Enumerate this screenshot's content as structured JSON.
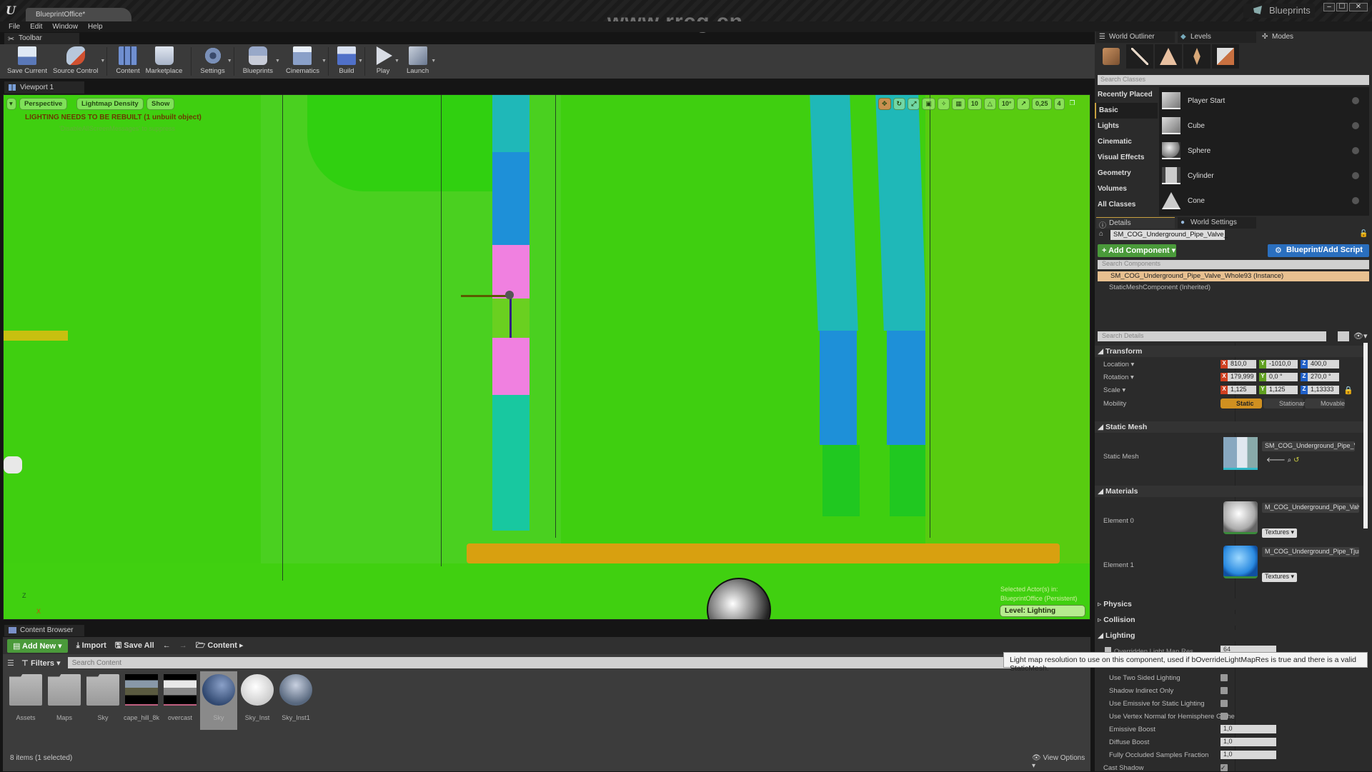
{
  "window": {
    "app_logo": "U",
    "document_tab": "BlueprintOffice*",
    "watermark_url": "www.rrcg.cn",
    "blueprints_badge": "Blueprints",
    "controls": [
      "–",
      "☐",
      "✕"
    ]
  },
  "menu": [
    "File",
    "Edit",
    "Window",
    "Help"
  ],
  "toolbar": {
    "tab_label": "Toolbar",
    "buttons": [
      {
        "label": "Save Current",
        "icon": "floppy-disk-icon",
        "color": "#8fb4e8"
      },
      {
        "label": "Source Control",
        "icon": "source-control-icon",
        "color": "#9ab0cc"
      },
      {
        "label": "Content",
        "icon": "content-grid-icon",
        "color": "#6f8fd0"
      },
      {
        "label": "Marketplace",
        "icon": "marketplace-bag-icon",
        "color": "#c8d4e8"
      },
      {
        "label": "Settings",
        "icon": "gear-icon",
        "color": "#7a90b8"
      },
      {
        "label": "Blueprints",
        "icon": "blueprint-icon",
        "color": "#98a8c8"
      },
      {
        "label": "Cinematics",
        "icon": "clapperboard-icon",
        "color": "#b8c8e0"
      },
      {
        "label": "Build",
        "icon": "build-blocks-icon",
        "color": "#6080d0"
      },
      {
        "label": "Play",
        "icon": "play-icon",
        "color": "#d8dce4"
      },
      {
        "label": "Launch",
        "icon": "launch-gamepad-icon",
        "color": "#b0bcd0"
      }
    ]
  },
  "viewport": {
    "tab_label": "Viewport 1",
    "view_mode": "Perspective",
    "shading_mode": "Lightmap Density",
    "show_label": "Show",
    "warning": "LIGHTING NEEDS TO BE REBUILT (1 unbuilt object)",
    "warning_hint": "'DisableAllScreenMessages' to suppress",
    "grid_snap": "10",
    "rotation_snap": "10°",
    "scale_snap": "0,25",
    "camera_speed": "4",
    "selected_info_line1": "Selected Actor(s) in:",
    "selected_info_line2": "BlueprintOffice (Persistent)",
    "level_label": "Level:  Lighting",
    "axis_z": "Z",
    "axis_x": "X"
  },
  "content_browser": {
    "tab_label": "Content Browser",
    "add_new": "Add New",
    "import": "Import",
    "save_all": "Save All",
    "path": "Content",
    "filters": "Filters",
    "search_placeholder": "Search Content",
    "assets": [
      {
        "name": "Assets",
        "type": "folder"
      },
      {
        "name": "Maps",
        "type": "folder"
      },
      {
        "name": "Sky",
        "type": "folder"
      },
      {
        "name": "cape_hill_8k",
        "type": "texture"
      },
      {
        "name": "overcast",
        "type": "texture"
      },
      {
        "name": "Sky",
        "type": "material",
        "selected": true
      },
      {
        "name": "Sky_Inst",
        "type": "material-instance"
      },
      {
        "name": "Sky_Inst1",
        "type": "material-instance"
      }
    ],
    "item_count": "8 items (1 selected)",
    "view_options": "View Options"
  },
  "right_panel": {
    "tabs": [
      "World Outliner",
      "Levels",
      "Modes"
    ],
    "search_classes_placeholder": "Search Classes",
    "categories": [
      "Recently Placed",
      "Basic",
      "Lights",
      "Cinematic",
      "Visual Effects",
      "Geometry",
      "Volumes",
      "All Classes"
    ],
    "selected_category": "Basic",
    "place_items": [
      "Player Start",
      "Cube",
      "Sphere",
      "Cylinder",
      "Cone"
    ],
    "details_tabs": [
      "Details",
      "World Settings"
    ],
    "object_name": "SM_COG_Underground_Pipe_Valve_",
    "add_component": "+ Add Component",
    "blueprint_script": "Blueprint/Add Script",
    "search_components_placeholder": "Search Components",
    "component_instance": "SM_COG_Underground_Pipe_Valve_Whole93 (Instance)",
    "component_inherited": "StaticMeshComponent (Inherited)",
    "search_details_placeholder": "Search Details",
    "transform": {
      "title": "Transform",
      "location_label": "Location",
      "location": [
        "810,0",
        "-1010,0",
        "400,0"
      ],
      "rotation_label": "Rotation",
      "rotation": [
        "179,999",
        "0,0 °",
        "270,0 °"
      ],
      "scale_label": "Scale",
      "scale": [
        "1,125",
        "1,125",
        "1,13333"
      ],
      "mobility_label": "Mobility",
      "mobility_options": [
        "Static",
        "Stationar",
        "Movable"
      ],
      "mobility_selected": "Static"
    },
    "static_mesh": {
      "title": "Static Mesh",
      "label": "Static Mesh",
      "value": "SM_COG_Underground_Pipe_Valv"
    },
    "materials": {
      "title": "Materials",
      "elements": [
        {
          "label": "Element 0",
          "value": "M_COG_Underground_Pipe_Valves",
          "textures": "Textures"
        },
        {
          "label": "Element 1",
          "value": "M_COG_Underground_Pipe_Tjunct",
          "textures": "Textures"
        }
      ]
    },
    "sections_collapsed": [
      "Physics",
      "Collision"
    ],
    "lighting": {
      "title": "Lighting",
      "overridden_lightmap_label": "Overridden Light Map Res",
      "overridden_lightmap_value": "64",
      "checkboxes": [
        {
          "label": "Use Two Sided Lighting",
          "checked": false
        },
        {
          "label": "Shadow Indirect Only",
          "checked": false
        },
        {
          "label": "Use Emissive for Static Lighting",
          "checked": false
        },
        {
          "label": "Use Vertex Normal for Hemisphere Gathe",
          "checked": false
        }
      ],
      "fields": [
        {
          "label": "Emissive Boost",
          "value": "1,0"
        },
        {
          "label": "Diffuse Boost",
          "value": "1,0"
        },
        {
          "label": "Fully Occluded Samples Fraction",
          "value": "1,0"
        }
      ],
      "cast_shadow_label": "Cast Shadow",
      "cast_shadow": true
    },
    "tooltip": "Light map resolution to use on this component, used if bOverrideLightMapRes is true and there is a valid StaticMesh."
  },
  "colors": {
    "viewport_green": "#3fcf10",
    "pipe_cyan": "#1fb8b8",
    "pipe_blue": "#1e90d8",
    "valve_pink": "#f080e0",
    "floor_orange": "#d8a010",
    "add_green": "#4a9a3a",
    "blueprint_blue": "#2a6fbf",
    "selection_tan": "#e8c090",
    "static_gold": "#d09020"
  }
}
